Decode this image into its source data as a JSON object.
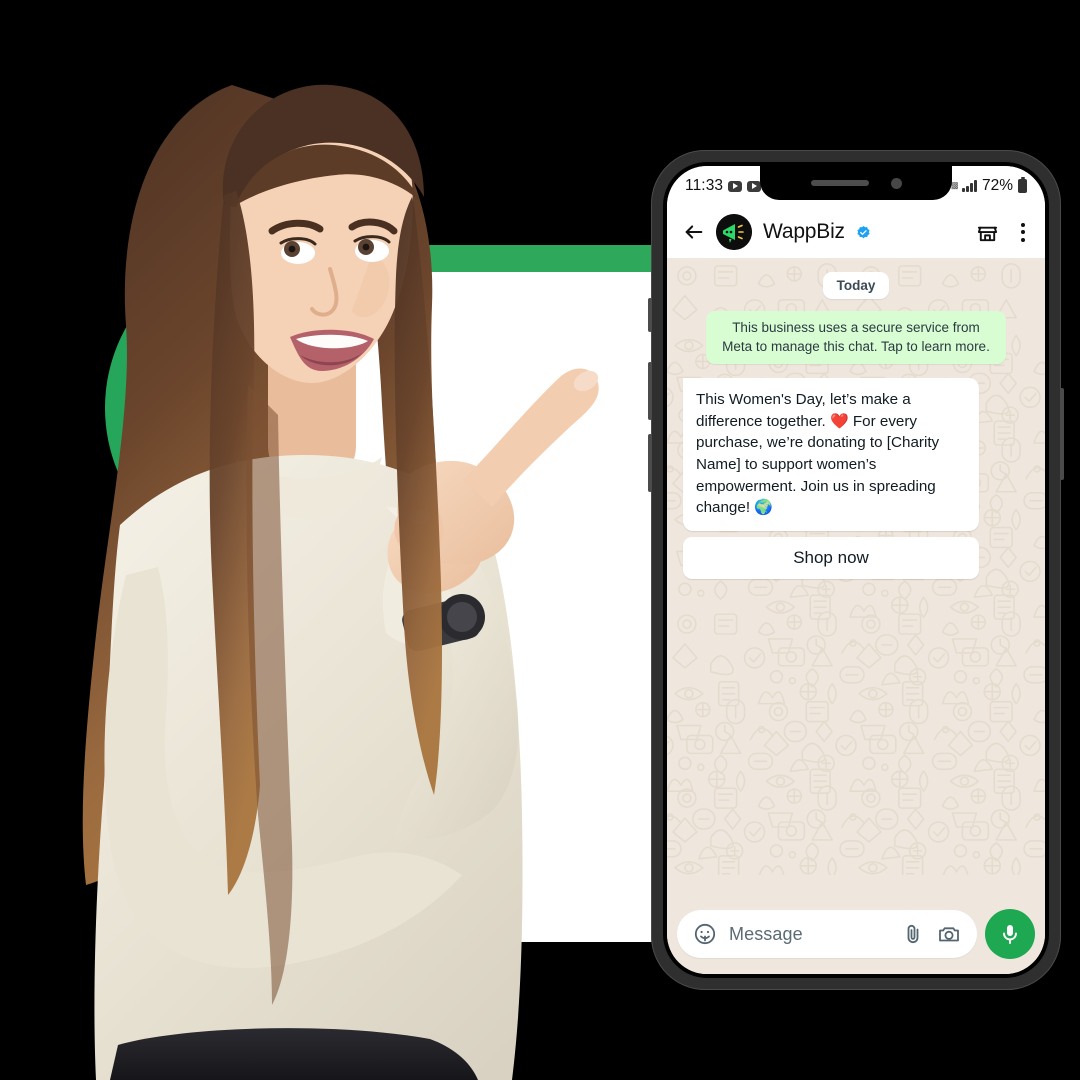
{
  "background": {
    "canvas_color": "#000000",
    "accent_green": "#26A65B",
    "card_header_green": "#2EA95C"
  },
  "phone": {
    "frame_color": "#2f2f2f",
    "status_bar": {
      "time": "11:33",
      "notification_icons": [
        "youtube-icon",
        "youtube-icon"
      ],
      "sim_label": "SIM",
      "signal_icon": "signal-bars-icon",
      "battery_percent": "72%",
      "battery_icon": "battery-icon"
    },
    "notch": {
      "speaker_icon": "speaker-slot",
      "camera_icon": "front-camera"
    }
  },
  "chat_header": {
    "back_icon": "back-arrow-icon",
    "avatar_icon": "megaphone-avatar",
    "contact_name": "WappBiz",
    "verified_icon": "verified-badge-icon",
    "shop_icon": "storefront-icon",
    "menu_icon": "kebab-menu-icon"
  },
  "chat": {
    "day_divider": "Today",
    "system_notice": "This business uses a secure service from Meta to manage this chat. Tap to learn more.",
    "message": {
      "part1": "This Women's Day, let’s make a difference together. ",
      "heart": "❤️",
      "part2": " For every purchase, we’re donating to [Charity Name] to support women’s empowerment. Join us in spreading change! ",
      "globe": "🌍"
    },
    "cta_label": "Shop now"
  },
  "input_bar": {
    "sticker_icon": "sticker-emoji-icon",
    "placeholder": "Message",
    "attach_icon": "paperclip-icon",
    "camera_icon": "camera-icon",
    "mic_icon": "microphone-icon",
    "mic_button_color": "#1DA851"
  }
}
